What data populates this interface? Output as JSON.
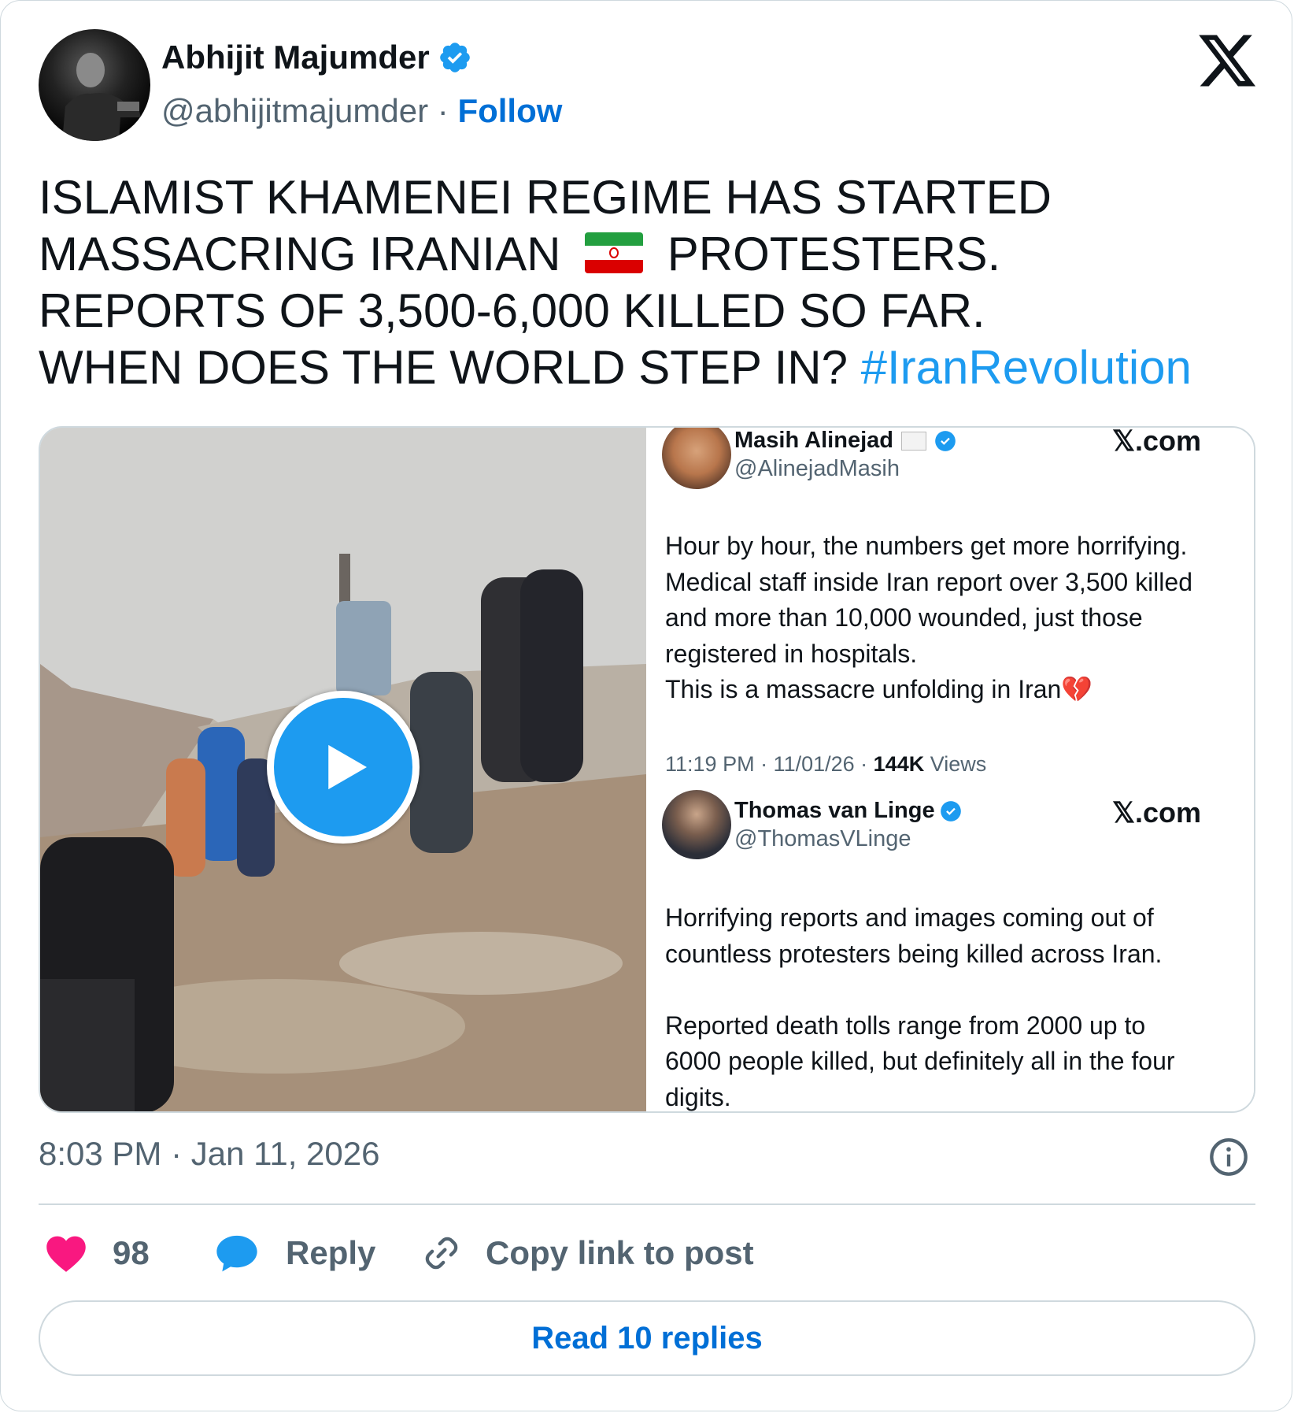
{
  "author": {
    "name": "Abhijit Majumder",
    "handle": "@abhijitmajumder",
    "separator": "·",
    "follow_label": "Follow"
  },
  "post": {
    "lines": [
      "ISLAMIST KHAMENEI REGIME HAS STARTED",
      "MASSACRING IRANIAN",
      "PROTESTERS.",
      "REPORTS OF 3,500-6,000 KILLED SO FAR.",
      "WHEN DOES THE WORLD STEP IN?"
    ],
    "hashtag": "#IranRevolution",
    "flag": "🇮🇷"
  },
  "media": {
    "quote1": {
      "name": "Masih Alinejad",
      "handle": "@AlinejadMasih",
      "source": "𝕏.com",
      "text_lines": [
        "Hour by hour, the numbers get more horrifying.",
        "Medical staff inside Iran report over 3,500 killed",
        "and more than 10,000 wounded, just those",
        "registered in hospitals.",
        "This is a massacre unfolding in Iran💔"
      ],
      "meta_prefix": "11:19 PM · 11/01/26 · ",
      "views_count": "144K",
      "views_label": " Views"
    },
    "quote2": {
      "name": "Thomas van Linge",
      "handle": "@ThomasVLinge",
      "source": "𝕏.com",
      "text_lines": [
        "Horrifying reports and images coming out of",
        "countless protesters being killed across Iran.",
        "",
        "Reported death tolls range from 2000 up to",
        "6000 people killed, but definitely all in the four",
        "digits."
      ]
    }
  },
  "timestamp": "8:03 PM · Jan 11, 2026",
  "actions": {
    "likes": "98",
    "reply_label": "Reply",
    "copy_label": "Copy link to post"
  },
  "read_replies_label": "Read 10 replies",
  "colors": {
    "accent": "#1d9bf0",
    "link": "#006fd6",
    "like": "#f91880",
    "muted": "#536471",
    "border": "#cfd9de"
  }
}
